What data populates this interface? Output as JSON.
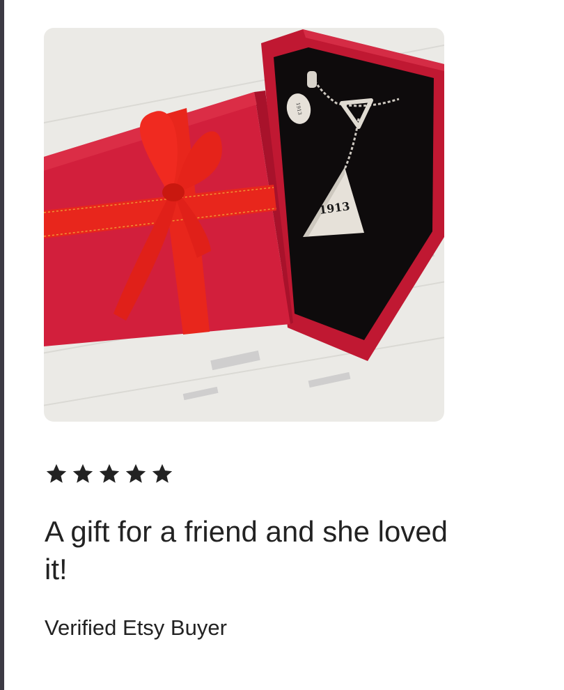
{
  "review": {
    "rating": 5,
    "rating_max": 5,
    "text": "A gift for a friend and she loved it!",
    "reviewer": "Verified Etsy Buyer"
  },
  "photo": {
    "pendant_engraving": "1913",
    "charm_engraving": "1913",
    "colors": {
      "box": "#d21f3c",
      "ribbon": "#e8261c",
      "velvet": "#0e0b0c",
      "silver": "#e6e1d9",
      "wood": "#ebeae6"
    }
  },
  "icons": {
    "star": "star-icon"
  },
  "colors": {
    "text": "#222222",
    "star": "#222222"
  }
}
